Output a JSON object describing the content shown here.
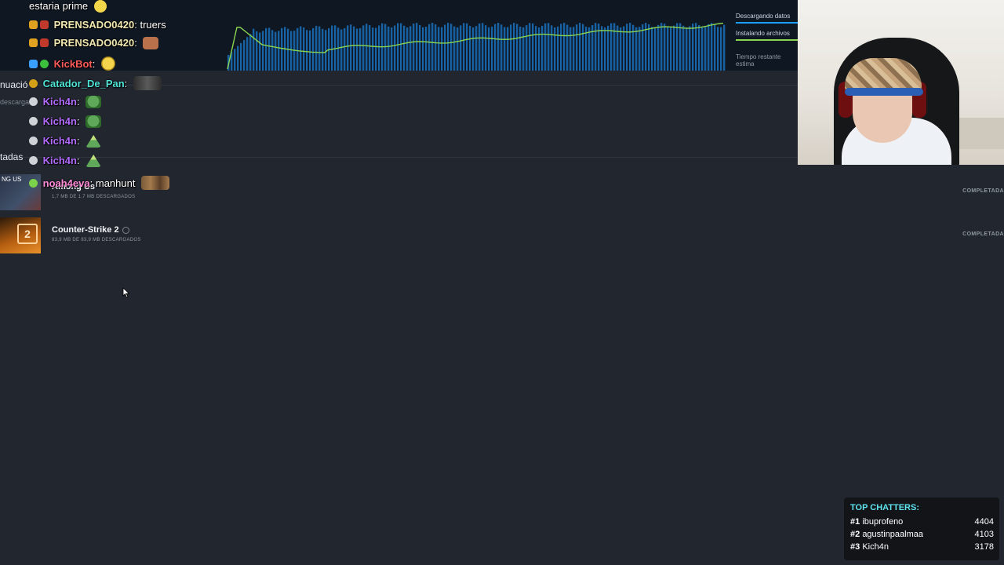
{
  "downloads_panel": {
    "legend_downloading": "Descargando datos",
    "legend_installing": "Instalando archivos",
    "legend_time_remaining": "Tiempo restante estima",
    "queue_section_cut": "nuació",
    "queue_sub_cut": "descargad",
    "completed_section_cut": "tadas",
    "games": [
      {
        "name": "Among Us",
        "size": "1,7 MB DE 1,7 MB DESCARGADOS",
        "status": "COMPLETADA",
        "thumb_text": "NG US"
      },
      {
        "name": "Counter-Strike 2",
        "size": "83,9 MB DE 83,9 MB DESCARGADOS",
        "status": "COMPLETADA",
        "thumb_text": "2"
      }
    ]
  },
  "chat": {
    "messages": [
      {
        "user": "",
        "text": "estaria prime",
        "user_color": "#ffffff"
      },
      {
        "user": "PRENSADO0420",
        "text": "truers",
        "user_color": "#f0e6b0"
      },
      {
        "user": "PRENSADO0420",
        "text": "",
        "user_color": "#f0e6b0"
      },
      {
        "user": "KickBot",
        "text": "",
        "user_color": "#ff5a5a"
      },
      {
        "user": "Catador_De_Pan",
        "text": "",
        "user_color": "#4fe3d6"
      },
      {
        "user": "Kich4n",
        "text": "",
        "user_color": "#b36bff"
      },
      {
        "user": "Kich4n",
        "text": "",
        "user_color": "#b36bff"
      },
      {
        "user": "Kich4n",
        "text": "",
        "user_color": "#b36bff"
      },
      {
        "user": "Kich4n",
        "text": "",
        "user_color": "#b36bff"
      },
      {
        "user": "noah4eva",
        "text": "manhunt",
        "user_color": "#ff8ad8"
      }
    ]
  },
  "top_chatters": {
    "title": "TOP CHATTERS:",
    "entries": [
      {
        "rank": "#1",
        "name": "ibuprofeno",
        "count": "4404"
      },
      {
        "rank": "#2",
        "name": "agustinpaalmaa",
        "count": "4103"
      },
      {
        "rank": "#3",
        "name": "Kich4n",
        "count": "3178"
      }
    ]
  },
  "colors": {
    "background": "#22262e",
    "graph_bg": "#0f1722",
    "download_bar": "#1a9fff",
    "install_line": "#8bd450",
    "top_chatters_title": "#5fe3ef"
  }
}
